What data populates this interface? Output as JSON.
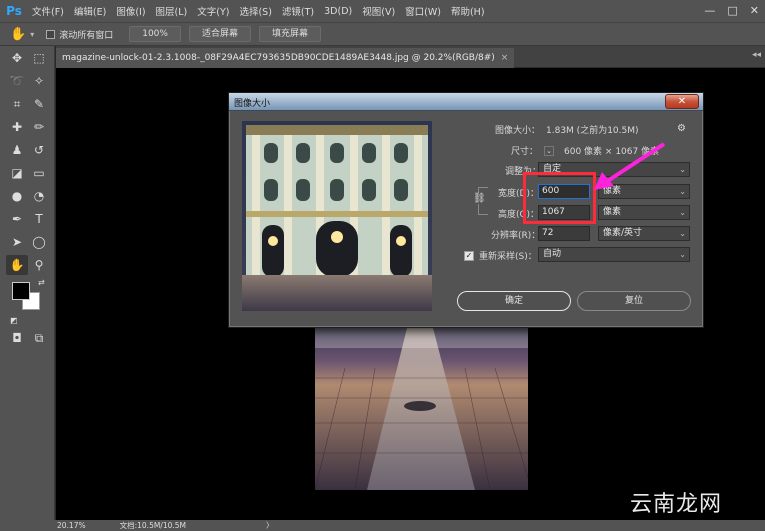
{
  "menubar": {
    "logo": "Ps",
    "items": [
      "文件(F)",
      "编辑(E)",
      "图像(I)",
      "图层(L)",
      "文字(Y)",
      "选择(S)",
      "滤镜(T)",
      "3D(D)",
      "视图(V)",
      "窗口(W)",
      "帮助(H)"
    ],
    "controls": [
      "—",
      "□",
      "✕"
    ]
  },
  "options_bar": {
    "checkbox_label": "滚动所有窗口",
    "zoom_button": "100%",
    "fit_button": "适合屏幕",
    "fill_button": "填充屏幕"
  },
  "document_tab": {
    "title": "magazine-unlock-01-2.3.1008-_08F29A4EC793635DB90CDE1489AE3448.jpg @ 20.2%(RGB/8#)",
    "close": "×"
  },
  "status_bar": {
    "zoom": "20.17%",
    "doc_info": "文档:10.5M/10.5M",
    "arrow": "〉"
  },
  "dialog": {
    "title": "图像大小",
    "close": "✕",
    "image_size_label": "图像大小：",
    "image_size_value": "1.83M (之前为10.5M)",
    "dimensions_label": "尺寸：",
    "dimensions_value": "600 像素 × 1067 像素",
    "fit_to_label": "调整为：",
    "fit_to_value": "自定",
    "width_label": "宽度(D)：",
    "width_value": "600",
    "width_unit": "像素",
    "height_label": "高度(G)：",
    "height_value": "1067",
    "height_unit": "像素",
    "resolution_label": "分辨率(R)：",
    "resolution_value": "72",
    "resolution_unit": "像素/英寸",
    "resample_label": "重新采样(S)：",
    "resample_value": "自动",
    "ok_label": "确定",
    "cancel_label": "复位"
  },
  "watermark": "云南龙网",
  "colors": {
    "highlight_box": "#ff2a3a",
    "annotation_arrow": "#ff22dd"
  }
}
